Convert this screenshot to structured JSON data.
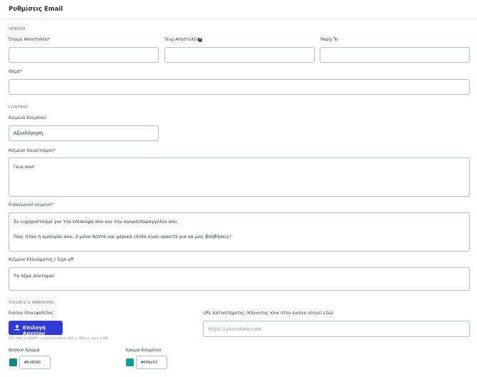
{
  "header": {
    "title": "Ρυθμίσεις Email"
  },
  "sender": {
    "section_label": "SENDER",
    "sender_name_label": "Όνομα Αποστολέα*",
    "sender_name_value": "",
    "sender_slug_label": "Slug Αποστολέα*",
    "sender_slug_value": "",
    "reply_to_label": "Reply To",
    "reply_to_value": "",
    "subject_label": "Θέμα*",
    "subject_value": ""
  },
  "content": {
    "section_label": "CONTENT",
    "button_text_label": "Κείμενο Κουμπιού",
    "button_text_value": "Αξιολόγηση",
    "greeting_label": "Κείμενο Χαιρετισμού*",
    "greeting_value": "Γεια σου!",
    "intro_label": "Εισαγωγικό κείμενο*",
    "intro_lines": [
      "Σε ευχαριστούμε για την επίσκεψή σου και την αγορά/παραγγελία σου.",
      "Πώς ήταν η εμπειρία σου; 2 μόνο λεπτά και μερικά clicks είναι αρκετά για να μας βοηθήσεις!"
    ],
    "signoff_label": "Κείμενο Κλεισίματος / Sign-off",
    "signoff_value": "Τα λέμε σύντομα!"
  },
  "visuals": {
    "section_label": "VISUALS & BRANDING",
    "image_label": "Εικόνα Επικεφαλίδας",
    "upload_button_label": "Επιλογή Αρχείου",
    "upload_hint": "JPG, PNG or WebP — recommended: 600 × 300 px, max 2 MB",
    "store_url_label": "URL Καταστήματος (Κάνοντας κλικ στην εικόνα οδηγεί εδώ)",
    "store_url_placeholder": "https://yourstore.com",
    "store_url_value": "",
    "main_color_label": "Βασικό Χρώμα",
    "main_color_value": "#0c8585",
    "button_color_label": "Χρώμα Κουμπιού",
    "button_color_value": "#099e97"
  },
  "colors": {
    "primary_button": "#2e3bd6",
    "main_swatch": "#0c8585",
    "button_swatch": "#099e97"
  },
  "icons": {
    "help": "question-circle-icon",
    "upload": "upload-icon"
  }
}
